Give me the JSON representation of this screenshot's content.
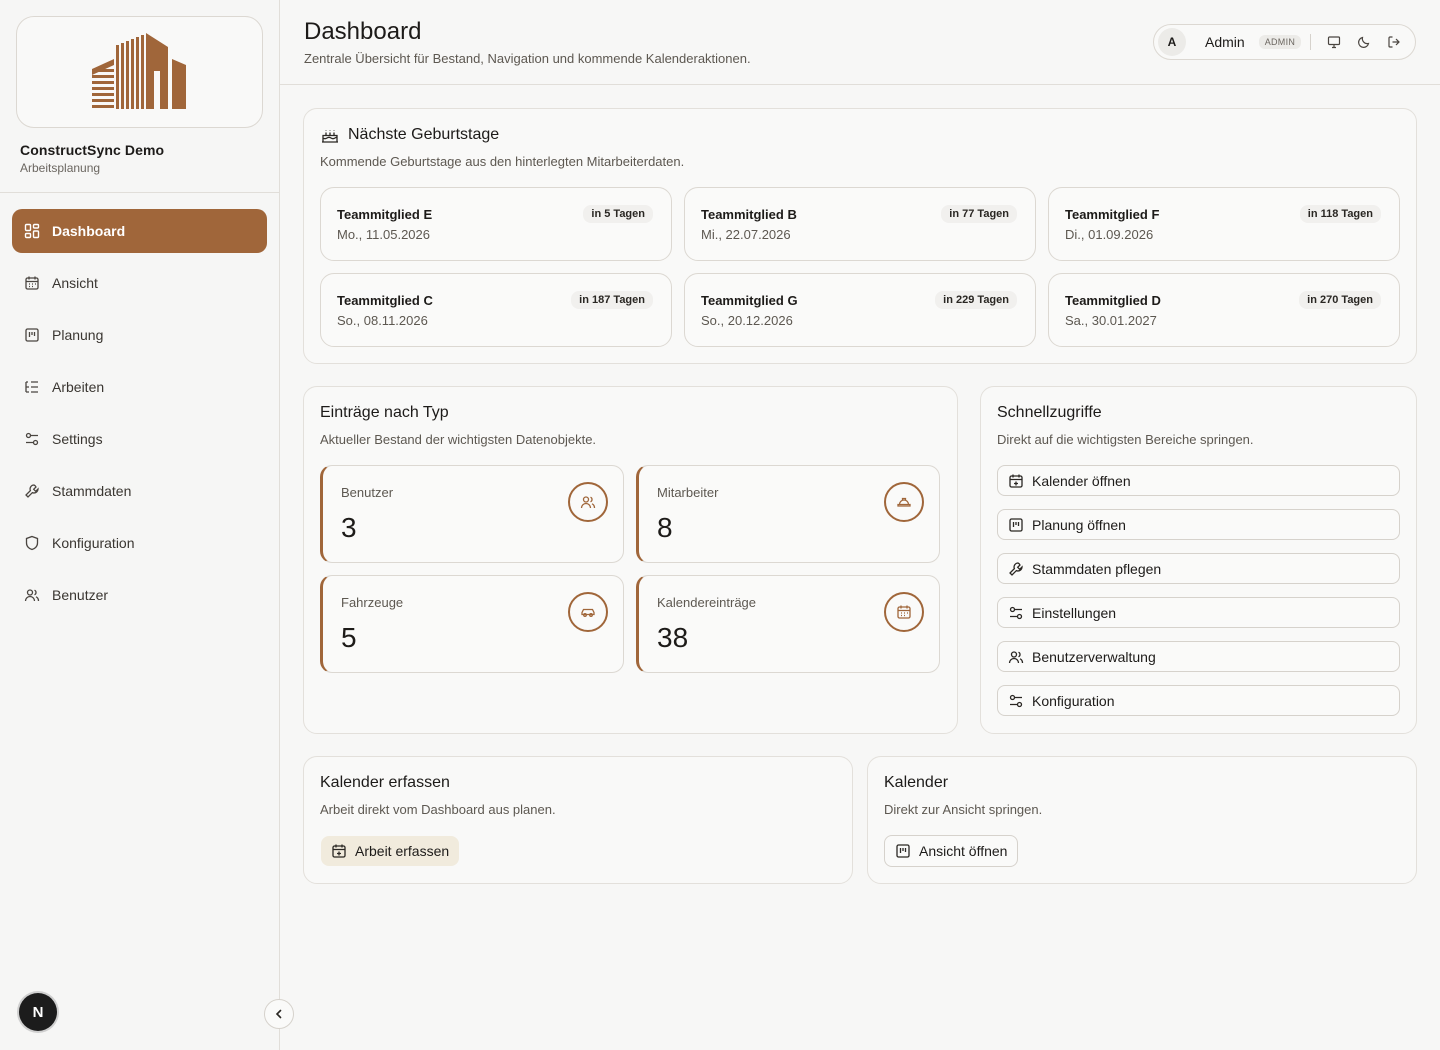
{
  "colors": {
    "accent": "#a0663a",
    "accent_soft": "#f1ebdd",
    "border": "#dcd8d2"
  },
  "sidebar": {
    "brand_name": "ConstructSync Demo",
    "brand_sub": "Arbeitsplanung",
    "items": [
      {
        "label": "Dashboard",
        "icon": "dashboard-icon"
      },
      {
        "label": "Ansicht",
        "icon": "calendar-icon"
      },
      {
        "label": "Planung",
        "icon": "planning-icon"
      },
      {
        "label": "Arbeiten",
        "icon": "list-icon"
      },
      {
        "label": "Settings",
        "icon": "sliders-icon"
      },
      {
        "label": "Stammdaten",
        "icon": "wrench-icon"
      },
      {
        "label": "Konfiguration",
        "icon": "shield-icon"
      },
      {
        "label": "Benutzer",
        "icon": "users-icon"
      }
    ],
    "badge": "N"
  },
  "header": {
    "title": "Dashboard",
    "subtitle": "Zentrale Übersicht für Bestand, Navigation und kommende Kalenderaktionen.",
    "avatar_initial": "A",
    "user_name": "Admin",
    "role": "ADMIN"
  },
  "birthdays": {
    "title": "Nächste Geburtstage",
    "subtitle": "Kommende Geburtstage aus den hinterlegten Mitarbeiterdaten.",
    "items": [
      {
        "name": "Teammitglied E",
        "date": "Mo., 11.05.2026",
        "in": "in 5 Tagen"
      },
      {
        "name": "Teammitglied B",
        "date": "Mi., 22.07.2026",
        "in": "in 77 Tagen"
      },
      {
        "name": "Teammitglied F",
        "date": "Di., 01.09.2026",
        "in": "in 118 Tagen"
      },
      {
        "name": "Teammitglied C",
        "date": "So., 08.11.2026",
        "in": "in 187 Tagen"
      },
      {
        "name": "Teammitglied G",
        "date": "So., 20.12.2026",
        "in": "in 229 Tagen"
      },
      {
        "name": "Teammitglied D",
        "date": "Sa., 30.01.2027",
        "in": "in 270 Tagen"
      }
    ]
  },
  "types": {
    "title": "Einträge nach Typ",
    "subtitle": "Aktueller Bestand der wichtigsten Datenobjekte.",
    "stats": [
      {
        "label": "Benutzer",
        "value": "3",
        "icon": "users-icon"
      },
      {
        "label": "Mitarbeiter",
        "value": "8",
        "icon": "hardhat-icon"
      },
      {
        "label": "Fahrzeuge",
        "value": "5",
        "icon": "car-icon"
      },
      {
        "label": "Kalendereinträge",
        "value": "38",
        "icon": "calendar-icon"
      }
    ]
  },
  "quick": {
    "title": "Schnellzugriffe",
    "subtitle": "Direkt auf die wichtigsten Bereiche springen.",
    "links": [
      {
        "label": "Kalender öffnen",
        "icon": "calendar-plus-icon"
      },
      {
        "label": "Planung öffnen",
        "icon": "planning-icon"
      },
      {
        "label": "Stammdaten pflegen",
        "icon": "wrench-icon"
      },
      {
        "label": "Einstellungen",
        "icon": "sliders-icon"
      },
      {
        "label": "Benutzerverwaltung",
        "icon": "users-icon"
      },
      {
        "label": "Konfiguration",
        "icon": "sliders-icon"
      }
    ]
  },
  "calendar_entry": {
    "title": "Kalender erfassen",
    "subtitle": "Arbeit direkt vom Dashboard aus planen.",
    "button": "Arbeit erfassen"
  },
  "calendar": {
    "title": "Kalender",
    "subtitle": "Direkt zur Ansicht springen.",
    "button": "Ansicht öffnen"
  }
}
